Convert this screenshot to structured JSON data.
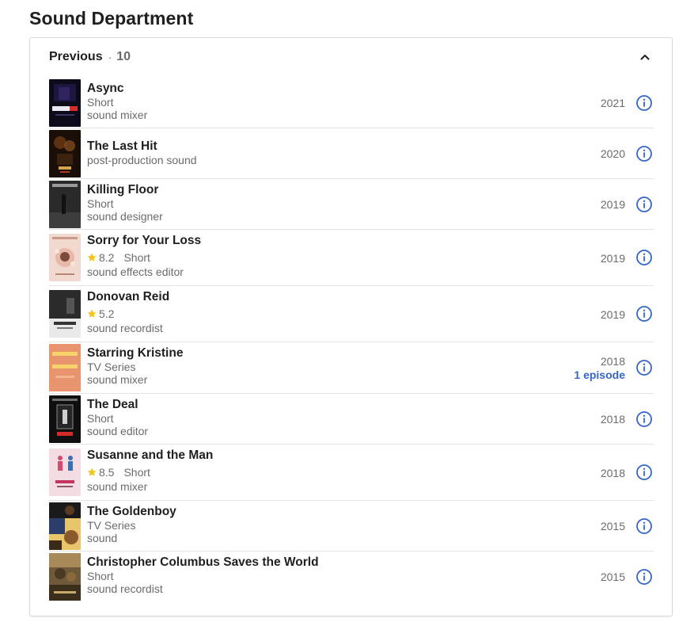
{
  "section": {
    "title": "Sound Department"
  },
  "panel": {
    "heading": "Previous",
    "separator": "·",
    "count": "10"
  },
  "colors": {
    "accent": "#3466c8",
    "star": "#f5c518",
    "muted": "#6b6b6b",
    "divider": "#e3e3e3"
  },
  "credits": [
    {
      "title": "Async",
      "type": "Short",
      "role": "sound mixer",
      "year": "2021"
    },
    {
      "title": "The Last Hit",
      "role": "post-production sound",
      "year": "2020"
    },
    {
      "title": "Killing Floor",
      "type": "Short",
      "role": "sound designer",
      "year": "2019"
    },
    {
      "title": "Sorry for Your Loss",
      "rating": "8.2",
      "type": "Short",
      "role": "sound effects editor",
      "year": "2019"
    },
    {
      "title": "Donovan Reid",
      "rating": "5.2",
      "role": "sound recordist",
      "year": "2019"
    },
    {
      "title": "Starring Kristine",
      "type": "TV Series",
      "role": "sound mixer",
      "year": "2018",
      "episodes": "1 episode"
    },
    {
      "title": "The Deal",
      "type": "Short",
      "role": "sound editor",
      "year": "2018"
    },
    {
      "title": "Susanne and the Man",
      "rating": "8.5",
      "type": "Short",
      "role": "sound mixer",
      "year": "2018"
    },
    {
      "title": "The Goldenboy",
      "type": "TV Series",
      "role": "sound",
      "year": "2015"
    },
    {
      "title": "Christopher Columbus Saves the World",
      "type": "Short",
      "role": "sound recordist",
      "year": "2015"
    }
  ]
}
